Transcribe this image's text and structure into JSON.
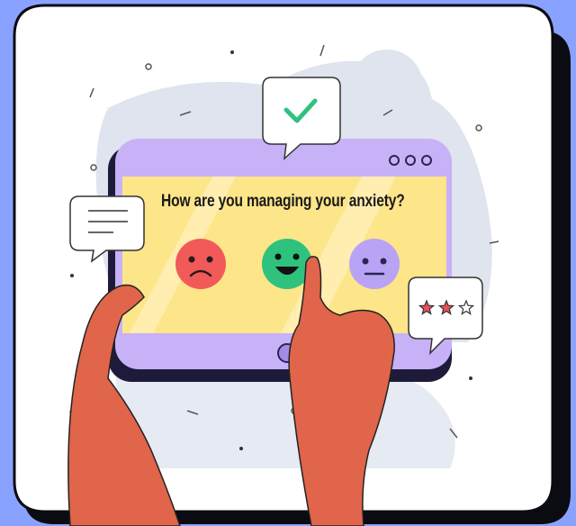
{
  "survey": {
    "question": "How are you managing your anxiety?",
    "options": [
      {
        "mood": "sad",
        "color": "#f25a5a",
        "selected": false
      },
      {
        "mood": "happy",
        "color": "#2ec27e",
        "selected": true
      },
      {
        "mood": "neutral",
        "color": "#b9a3f5",
        "selected": false
      }
    ]
  },
  "rating": {
    "filled_stars": 2,
    "total_stars": 3
  },
  "colors": {
    "background": "#8aa2ff",
    "card": "#ffffff",
    "tablet_frame": "#c7b2f7",
    "screen": "#fde58a",
    "hands": "#e0654a",
    "check": "#2ec27e"
  }
}
